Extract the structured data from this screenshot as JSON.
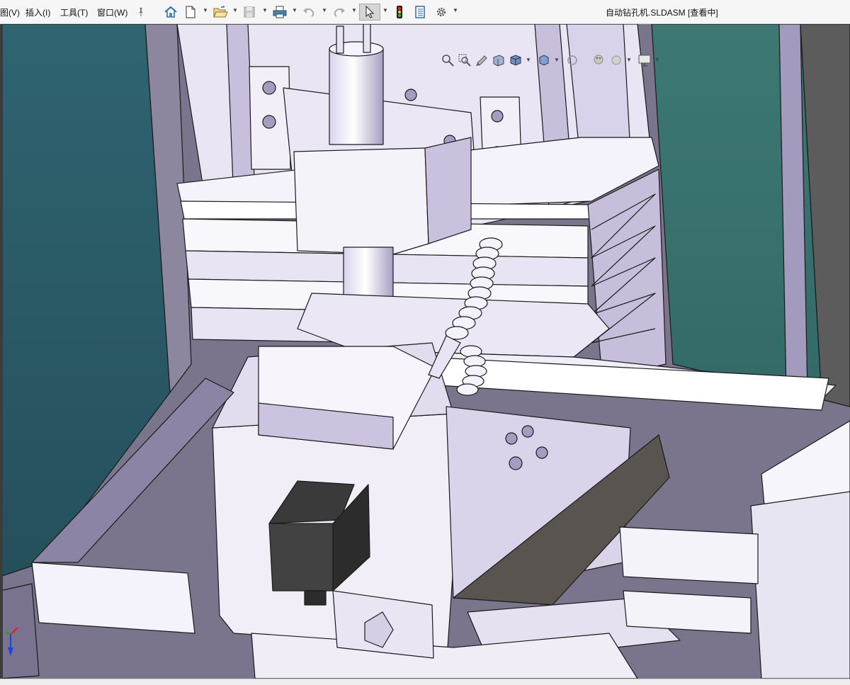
{
  "menu": {
    "view": "图(V)",
    "insert": "插入(I)",
    "tools": "工具(T)",
    "window": "窗口(W)"
  },
  "document": {
    "title": "自动钻孔机.SLDASM [查看中]"
  },
  "toolbar_icons": [
    "home-icon",
    "new-file-icon",
    "open-folder-icon",
    "save-icon",
    "print-icon",
    "undo-icon",
    "redo-icon",
    "select-arrow-icon",
    "traffic-light-icon",
    "file-properties-icon",
    "gear-icon",
    "pin-icon"
  ],
  "heads_up_icons": [
    "zoom-to-fit-icon",
    "zoom-area-icon",
    "previous-view-icon",
    "section-view-icon",
    "view-orientation-icon",
    "display-style-icon",
    "hide-show-icon",
    "edit-appearance-icon",
    "apply-scene-icon",
    "view-settings-icon"
  ],
  "colors": {
    "toolbar_bg": "#f6f6f6",
    "viewport_bg_left": "#2c5f69",
    "viewport_bg_right": "#3a7370",
    "model_face_light": "#eeeaf7",
    "model_face_mid": "#b9b1d0",
    "model_face_dark": "#8c84a6",
    "motor_color": "#3a3a3a",
    "edge_color": "#1a1a1a",
    "triad_x": "#e02020",
    "triad_y": "#20a020",
    "triad_z": "#2040e0"
  }
}
